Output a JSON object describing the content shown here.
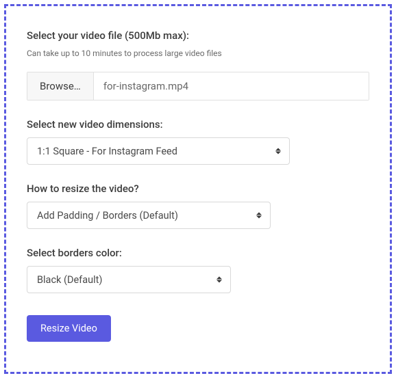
{
  "fileSection": {
    "label": "Select your video file (500Mb max):",
    "hint": "Can take up to 10 minutes to process large video files",
    "browseLabel": "Browse…",
    "fileName": "for-instagram.mp4"
  },
  "dimensions": {
    "label": "Select new video dimensions:",
    "selected": "1:1 Square - For Instagram Feed"
  },
  "resizeMethod": {
    "label": "How to resize the video?",
    "selected": "Add Padding / Borders (Default)"
  },
  "borderColor": {
    "label": "Select borders color:",
    "selected": "Black (Default)"
  },
  "submit": {
    "label": "Resize Video"
  },
  "colors": {
    "accent": "#5a5ae0"
  }
}
